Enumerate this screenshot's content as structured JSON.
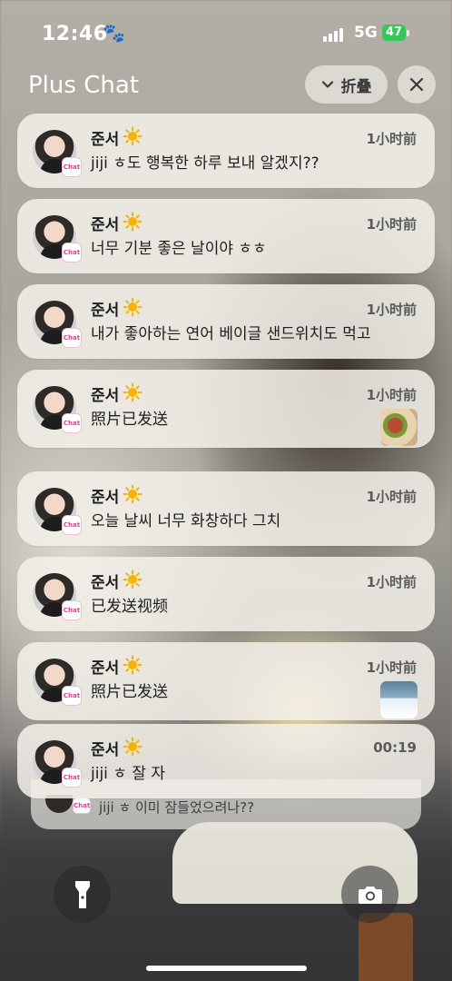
{
  "status_bar": {
    "time": "12:46",
    "network": "5G",
    "battery": "47",
    "icons": [
      "paw-icon",
      "signal-icon",
      "battery-icon"
    ]
  },
  "header": {
    "title": "Plus Chat",
    "collapse_label": "折叠",
    "icons": [
      "chevron-down-icon",
      "close-icon"
    ]
  },
  "notifications": [
    {
      "sender": "준서",
      "message": "jiji ㅎ도 행복한 하루 보내 알겠지??",
      "time": "1小时前"
    },
    {
      "sender": "준서",
      "message": "너무 기분 좋은 날이야 ㅎㅎ",
      "time": "1小时前"
    },
    {
      "sender": "준서",
      "message": "내가 좋아하는 연어 베이글 샌드위치도 먹고",
      "time": "1小时前"
    },
    {
      "sender": "준서",
      "message": "照片已发送",
      "time": "1小时前",
      "thumbnail": "food-photo"
    },
    {
      "sender": "준서",
      "message": "오늘 날씨 너무 화창하다 그치",
      "time": "1小时前"
    },
    {
      "sender": "준서",
      "message": "已发送视频",
      "time": "1小时前"
    },
    {
      "sender": "준서",
      "message": "照片已发送",
      "time": "1小时前",
      "thumbnail": "snow-photo"
    },
    {
      "sender": "준서",
      "message": "jiji ㅎ 잘 자",
      "time": "00:19"
    }
  ],
  "stacked_notification": {
    "message": "jiji ㅎ 이미 잠들었으려나??"
  },
  "app_badge": "Chat",
  "bottom_controls": {
    "left": "flashlight-icon",
    "right": "camera-icon"
  },
  "colors": {
    "battery": "#34c759",
    "badge_pink": "#e33f8b"
  }
}
